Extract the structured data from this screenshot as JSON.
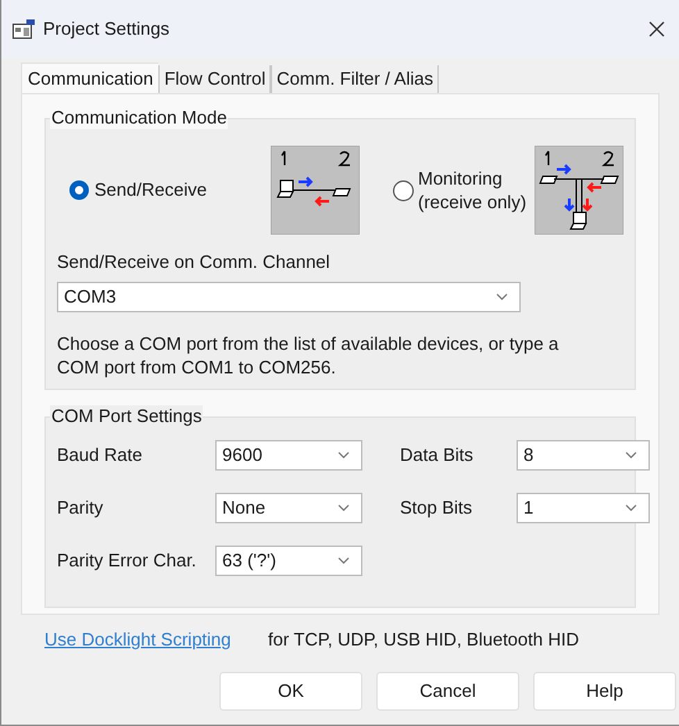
{
  "window": {
    "title": "Project Settings"
  },
  "tabs": [
    {
      "label": "Communication",
      "selected": true
    },
    {
      "label": "Flow Control",
      "selected": false
    },
    {
      "label": "Comm. Filter / Alias",
      "selected": false
    }
  ],
  "communication_mode": {
    "title": "Communication Mode",
    "options": [
      {
        "label": "Send/Receive",
        "selected": true,
        "kind": "send"
      },
      {
        "label": "Monitoring (receive only)",
        "selected": false,
        "kind": "monitor"
      }
    ],
    "channel_label": "Send/Receive on Comm. Channel",
    "channel_value": "COM3",
    "hint": "Choose a COM port from the list of available devices, or type a COM port from COM1 to COM256."
  },
  "com_port_settings": {
    "title": "COM Port Settings",
    "fields": [
      {
        "label": "Baud Rate",
        "value": "9600"
      },
      {
        "label": "Data Bits",
        "value": "8"
      },
      {
        "label": "Parity",
        "value": "None"
      },
      {
        "label": "Stop Bits",
        "value": "1"
      },
      {
        "label": "Parity Error Char.",
        "value": "63 ('?')"
      }
    ]
  },
  "link": "Use Docklight Scripting",
  "link_note": "for TCP, UDP, USB HID, Bluetooth HID",
  "buttons": [
    "OK",
    "Cancel",
    "Help"
  ]
}
